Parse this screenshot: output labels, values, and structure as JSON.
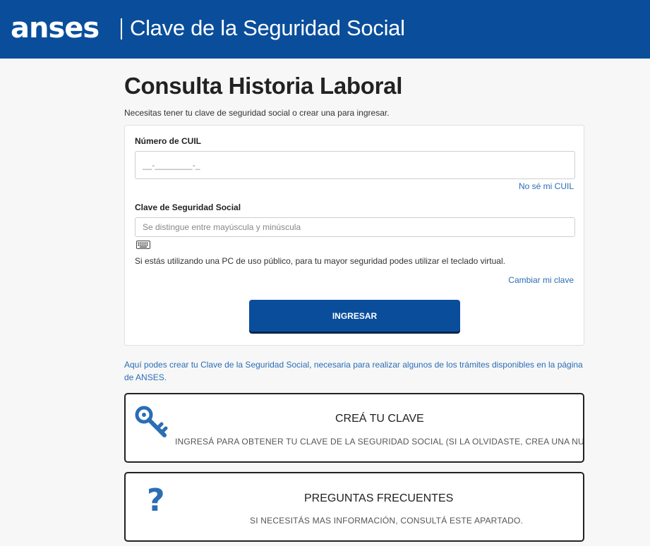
{
  "header": {
    "logo": "anses",
    "title": "Clave de la Seguridad Social"
  },
  "page": {
    "title": "Consulta Historia Laboral",
    "subtitle": "Necesitas tener tu clave de seguridad social o crear una para ingresar."
  },
  "form": {
    "cuil_label": "Número de CUIL",
    "cuil_placeholder": "__-________-_",
    "cuil_link": "No sé mi CUIL",
    "clave_label": "Clave de Seguridad Social",
    "clave_placeholder": "Se distingue entre mayúscula y minúscula",
    "hint": "Si estás utilizando una PC de uso público, para tu mayor seguridad podes utilizar el teclado virtual.",
    "change_link": "Cambiar mi clave",
    "submit_label": "INGRESAR"
  },
  "info": {
    "text": "Aquí podes crear tu Clave de la Seguridad Social, necesaria para realizar algunos de los trámites disponibles en la página de ANSES."
  },
  "tiles": [
    {
      "title": "CREÁ TU CLAVE",
      "description": "INGRESÁ PARA OBTENER TU CLAVE DE LA SEGURIDAD SOCIAL (SI LA OLVIDASTE, CREA UNA NUEVA",
      "icon": "key-icon"
    },
    {
      "title": "PREGUNTAS FRECUENTES",
      "description": "SI NECESITÁS MAS INFORMACIÓN, CONSULTÁ ESTE APARTADO.",
      "icon": "question-icon",
      "glyph": "?"
    }
  ],
  "colors": {
    "brand": "#0a4e9b",
    "link": "#2a6eb5",
    "background": "#f7f7f7"
  }
}
